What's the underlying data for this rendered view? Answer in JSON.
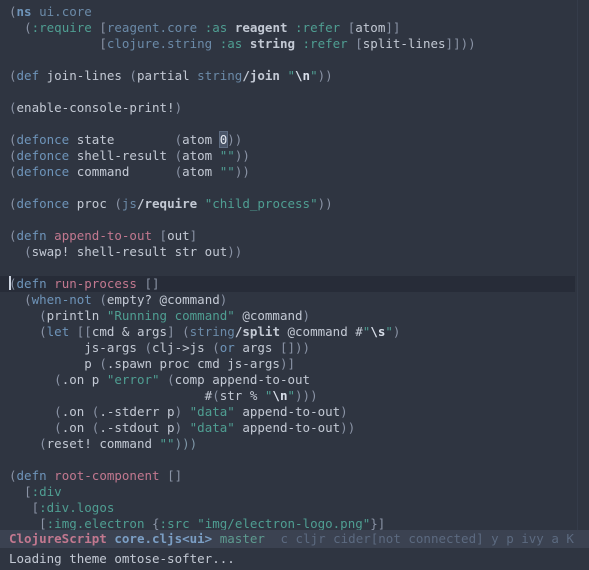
{
  "editor": {
    "app": "Emacs",
    "theme_name": "omtose-softer",
    "background": "#2f3541",
    "current_line_background": "#272c38",
    "default_foreground": "#c3c9d4"
  },
  "colors": {
    "keyword": "#6e94b9",
    "function_name": "#c2788f",
    "string": "#4f9e92",
    "namespace": "#6b8aa8",
    "paren": "#8a93a5",
    "modeline_bg": "#3b4251",
    "modeline_major": "#c2788f",
    "modeline_buffer": "#7b9ec4",
    "modeline_branch": "#5d9a8f",
    "modeline_minor": "#5c6a80"
  },
  "buffer": {
    "name": "core.cljs",
    "language": "ClojureScript",
    "lines": [
      "(ns ui.core",
      "  (:require [reagent.core :as reagent :refer [atom]]",
      "            [clojure.string :as string :refer [split-lines]]))",
      "",
      "(def join-lines (partial string/join \"\\n\"))",
      "",
      "(enable-console-print!)",
      "",
      "(defonce state        (atom 0))",
      "(defonce shell-result (atom \"\"))",
      "(defonce command      (atom \"\"))",
      "",
      "(defonce proc (js/require \"child_process\"))",
      "",
      "(defn append-to-out [out]",
      "  (swap! shell-result str out))",
      "",
      "(defn run-process []",
      "  (when-not (empty? @command)",
      "    (println \"Running command\" @command)",
      "    (let [[cmd & args] (string/split @command #\"\\s\")",
      "          js-args (clj->js (or args []))",
      "          p (.spawn proc cmd js-args)]",
      "      (.on p \"error\" (comp append-to-out",
      "                          #(str % \"\\n\")))",
      "      (.on (.-stderr p) \"data\" append-to-out)",
      "      (.on (.-stdout p) \"data\" append-to-out))",
      "    (reset! command \"\")))",
      "",
      "(defn root-component []",
      "  [:div",
      "   [:div.logos",
      "    [:img.electron {:src \"img/electron-logo.png\"}]"
    ],
    "current_line_index": 17,
    "cursor_highlight_text": "0",
    "cursor_highlight_line_index": 8
  },
  "modeline": {
    "major_mode": "ClojureScript",
    "buffer_name": "core.cljs<ui>",
    "vc_branch": "master",
    "minor_modes": "c cljr cider[not connected] y p ivy a K"
  },
  "echo_area": {
    "message": "Loading theme omtose-softer..."
  }
}
